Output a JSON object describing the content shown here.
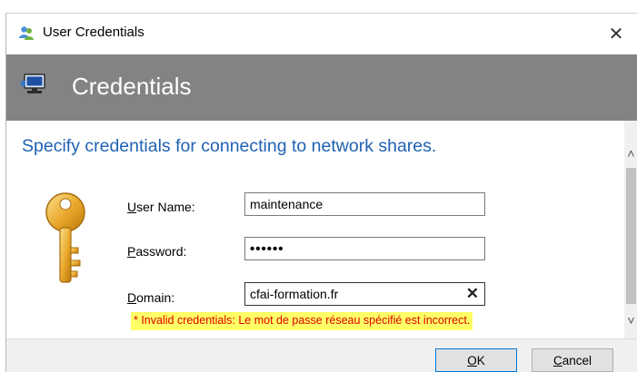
{
  "window": {
    "title": "User Credentials",
    "close_glyph": "✕"
  },
  "banner": {
    "title": "Credentials"
  },
  "main": {
    "heading": "Specify credentials for connecting to network shares."
  },
  "form": {
    "username": {
      "label_accel": "U",
      "label_rest": "ser Name:",
      "value": "maintenance"
    },
    "password": {
      "label_accel": "P",
      "label_rest": "assword:",
      "masked": "••••••"
    },
    "domain": {
      "label_accel": "D",
      "label_rest": "omain:",
      "value": "cfai-formation.fr",
      "clear_glyph": "✕"
    },
    "error": "* Invalid credentials: Le mot de passe réseau spécifié est incorrect."
  },
  "buttons": {
    "ok": {
      "accel": "O",
      "rest": "K"
    },
    "cancel": {
      "accel": "C",
      "rest": "ancel"
    }
  },
  "scrollbar": {
    "up_glyph": "˄",
    "down_glyph": "˅"
  },
  "colors": {
    "heading_blue": "#1f62b2",
    "banner_gray": "#838385",
    "error_red": "#e00000",
    "error_highlight": "#ffff66",
    "default_button_border": "#0078d7"
  }
}
